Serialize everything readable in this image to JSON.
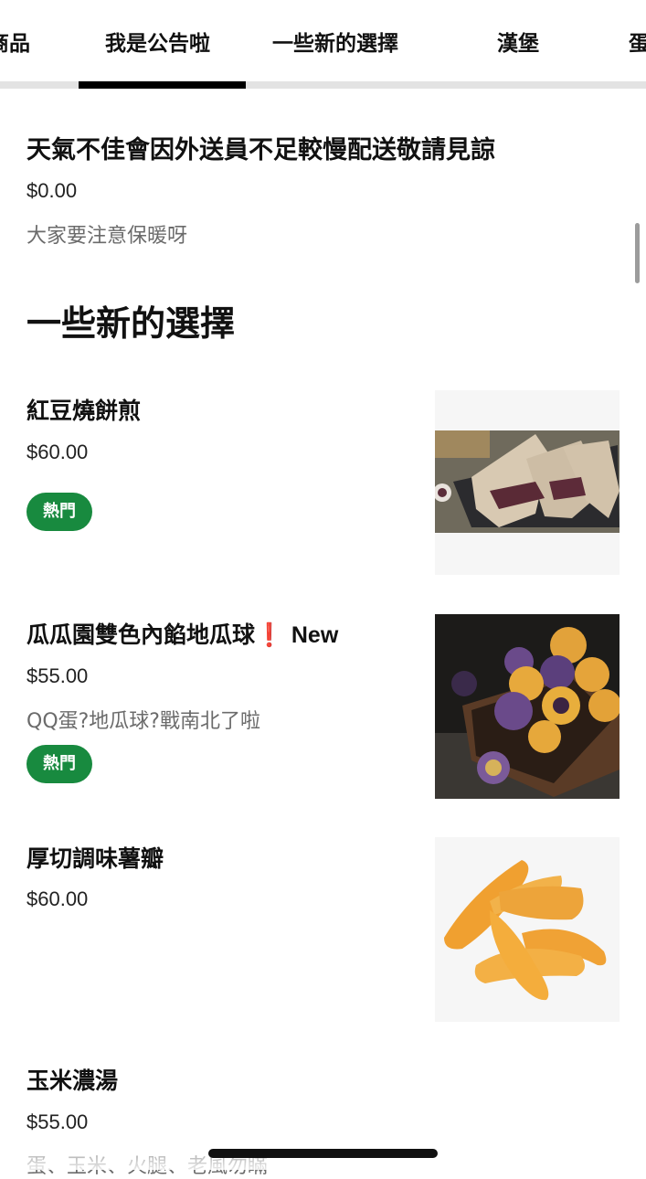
{
  "tabs": [
    {
      "label": "商品"
    },
    {
      "label": "我是公告啦"
    },
    {
      "label": "一些新的選擇"
    },
    {
      "label": "漢堡"
    },
    {
      "label": "蛋"
    }
  ],
  "notice": {
    "title": "天氣不佳會因外送員不足較慢配送敬請見諒",
    "price": "$0.00",
    "description": "大家要注意保暖呀"
  },
  "section": {
    "title": "一些新的選擇"
  },
  "items": [
    {
      "name": "紅豆燒餅煎",
      "price": "$60.00",
      "badge": "熱門",
      "image": "red-bean-pancake"
    },
    {
      "name": "瓜瓜園雙色內餡地瓜球",
      "flag": "❗",
      "tag": "New",
      "price": "$55.00",
      "description": "QQ蛋?地瓜球?戰南北了啦",
      "badge": "熱門",
      "image": "sweet-potato-balls"
    },
    {
      "name": "厚切調味薯瓣",
      "price": "$60.00",
      "image": "potato-wedges"
    },
    {
      "name": "玉米濃湯",
      "price": "$55.00",
      "description": "蛋、玉米、火腿、老風勿瞞"
    }
  ],
  "colors": {
    "badge": "#188a3f",
    "indicator": "#000000",
    "flag": "#d71920"
  }
}
